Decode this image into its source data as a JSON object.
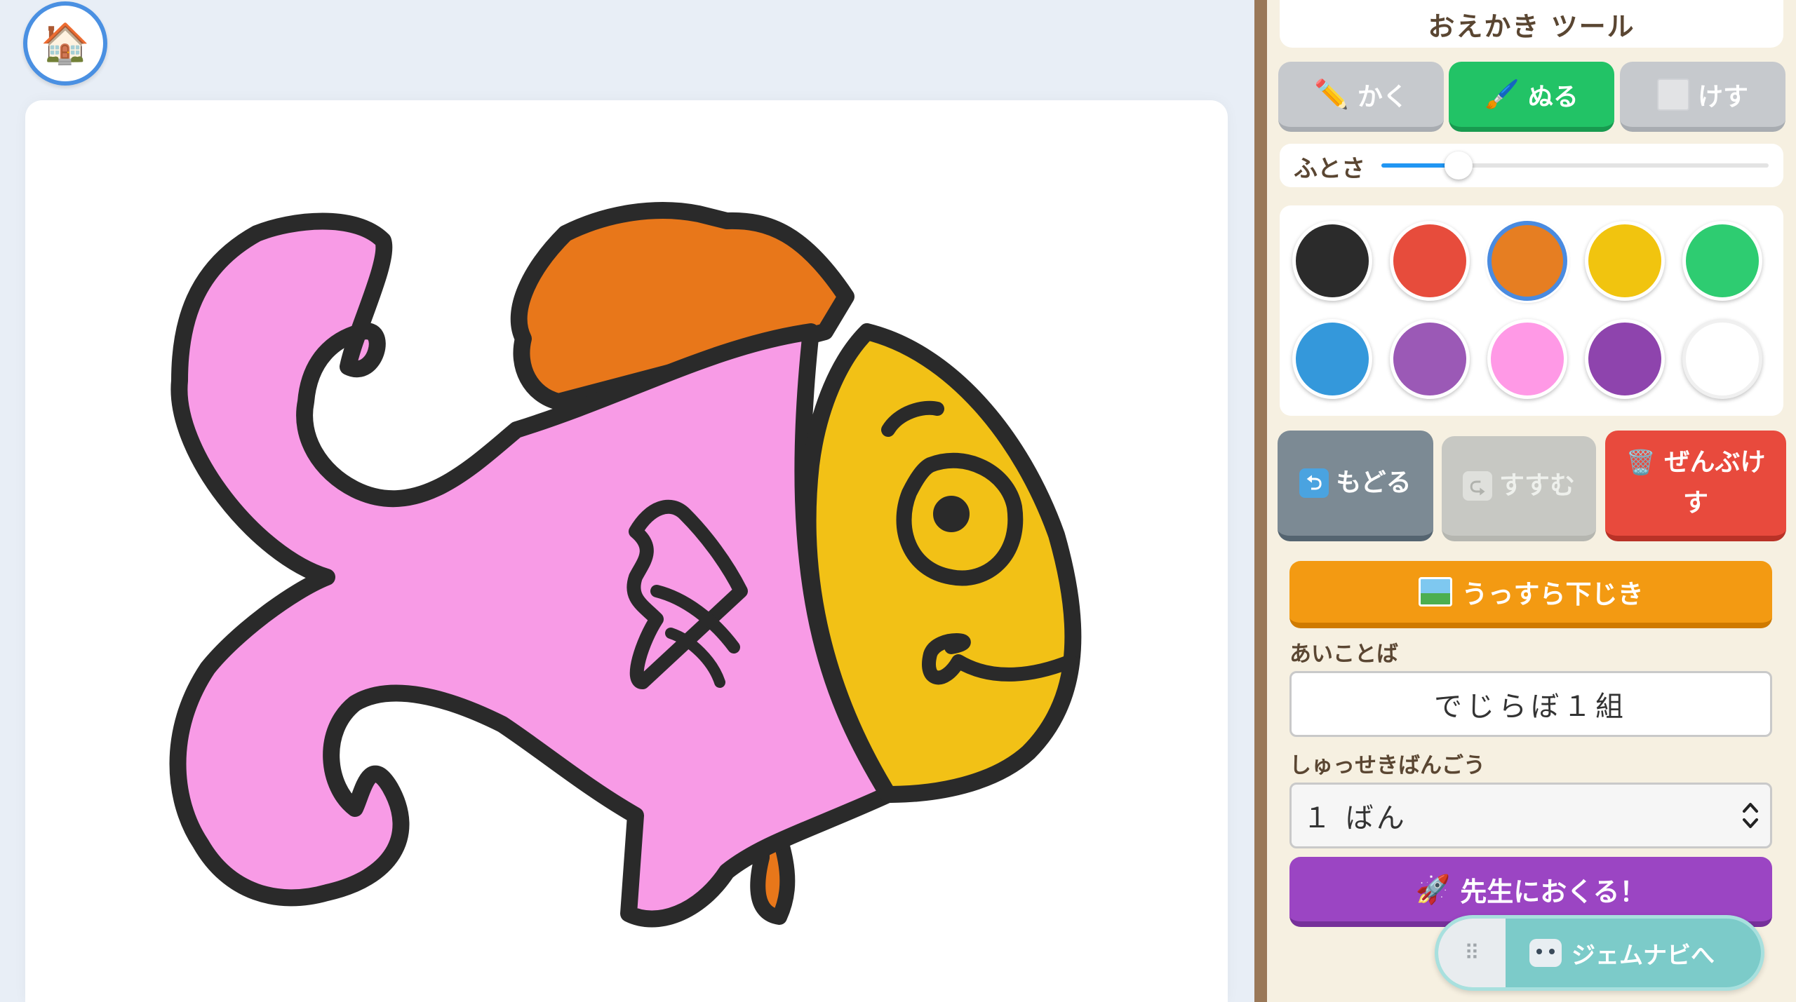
{
  "home": {
    "icon": "🏠"
  },
  "panel": {
    "title": "おえかき ツール",
    "modes": [
      {
        "icon": "✏️",
        "label": "かく",
        "active": false
      },
      {
        "icon": "🖌️",
        "label": "ぬる",
        "active": true
      },
      {
        "label": "けす",
        "active": false
      }
    ],
    "stroke_width": {
      "label": "ふとさ",
      "level": 0.2
    },
    "colors": {
      "swatches": [
        "#2b2b2b",
        "#e74c3c",
        "#e67e22",
        "#f1c40f",
        "#2ecc71",
        "#3498db",
        "#9b59b6",
        "#ff99e6",
        "#8e44ad",
        "#ffffff"
      ],
      "selected_index": 2
    },
    "actions": {
      "undo_label": "もどる",
      "redo_label": "すすむ",
      "clear_label": "ぜんぶけす",
      "clear_icon": "🗑️"
    },
    "trace_label": "うっすら下じき",
    "passphrase": {
      "label": "あいことば",
      "value": "でじらぼ１組"
    },
    "student_no": {
      "label": "しゅっせきばんごう",
      "value": "１ ばん"
    },
    "send": {
      "icon": "🚀",
      "label": "先生におくる！"
    }
  },
  "navi": {
    "label": "ジェムナビへ",
    "grip_icon": "⠿"
  },
  "colors": {
    "fish_body": "#f89be6",
    "fish_face": "#f2c116",
    "fish_fin": "#e8771a",
    "outline": "#2a2a2a"
  }
}
